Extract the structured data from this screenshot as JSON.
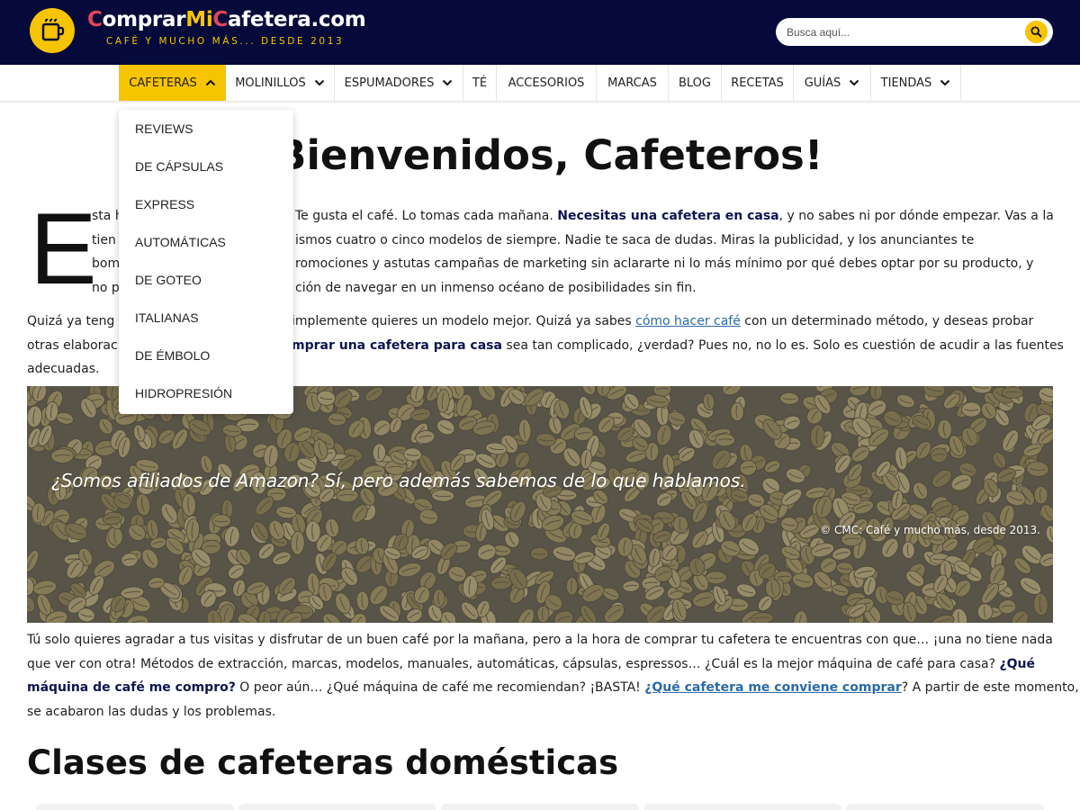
{
  "brand": {
    "title_part1": "Comprar",
    "title_part2": "Mi",
    "title_part3": "Cafetera",
    "title_part4": ".com",
    "title_first_letter": "C",
    "tagline": "CAFÉ Y MUCHO MÁS... DESDE 2013",
    "colors": {
      "header_bg": "#050a3a",
      "accent": "#f6c400",
      "logo_red": "#e2465a",
      "link": "#2b6aa8"
    },
    "logo_icon": "coffee-cup-icon"
  },
  "search": {
    "placeholder": "Busca aquí...",
    "icon": "search-icon"
  },
  "nav": {
    "items": [
      {
        "label": "CAFETERAS",
        "has_dropdown": true,
        "active": true
      },
      {
        "label": "MOLINILLOS",
        "has_dropdown": true
      },
      {
        "label": "ESPUMADORES",
        "has_dropdown": true
      },
      {
        "label": "TÉ",
        "has_dropdown": false
      },
      {
        "label": "ACCESORIOS",
        "has_dropdown": false
      },
      {
        "label": "MARCAS",
        "has_dropdown": false
      },
      {
        "label": "BLOG",
        "has_dropdown": false
      },
      {
        "label": "RECETAS",
        "has_dropdown": false
      },
      {
        "label": "GUÍAS",
        "has_dropdown": true
      },
      {
        "label": "TIENDAS",
        "has_dropdown": true
      }
    ],
    "dropdown": [
      "REVIEWS",
      "DE CÁPSULAS",
      "EXPRESS",
      "AUTOMÁTICAS",
      "DE GOTEO",
      "ITALIANAS",
      "DE ÉMBOLO",
      "HIDROPRESIÓN"
    ]
  },
  "main": {
    "heading": "¡Bienvenidos, Cafeteros!",
    "intro": {
      "dropcap": "E",
      "line1_a": "sta h",
      "line1_b": "Te gusta el café. Lo tomas cada mañana. ",
      "line1_bold": "Necesitas una cafetera en casa",
      "line1_c": ", y no sabes ni por dónde empezar. Vas a la",
      "line2_a": "tien",
      "line2_b": "ismos cuatro o cinco modelos de siempre. Nadie te saca de dudas. Miras la publicidad, y los anunciantes te",
      "line3_a": "bom",
      "line3_b": "romociones y astutas campañas de marketing sin aclararte ni lo más mínimo por qué debes optar por su producto, y",
      "line4_a": "no p",
      "line4_b": "ción de navegar en un inmenso océano de posibilidades sin fin."
    },
    "para2": {
      "line1_a": "Quizá ya teng",
      "line1_b": "implemente quieres un modelo mejor.  Quizá ya sabes ",
      "line1_link": "cómo hacer café",
      "line1_c": " con un determinado método, y deseas probar",
      "line2_a": "otras elaborac",
      "line2_bold": "mprar una cafetera para casa",
      "line2_c": " sea tan complicado, ¿verdad? Pues no, no lo es. Solo es cuestión de acudir a las fuentes",
      "line3": "adecuadas."
    },
    "hero": {
      "tagline": "¿Somos afiliados de Amazon? Sí, pero además sabemos de lo que hablamos.",
      "credit": "© CMC: Café y mucho más, desde 2013."
    },
    "para3": {
      "line1": "Tú solo quieres agradar a tus visitas y disfrutar de un buen café por la mañana, pero a la hora de comprar tu cafetera te encuentras con que… ¡una no tiene nada",
      "line2_a": "que ver con otra! Métodos de extracción, marcas, modelos, manuales, automáticas, cápsulas, espressos… ¿Cuál es la mejor máquina de café para casa? ",
      "line2_bold": "¿Qué",
      "line3_bold": "máquina de café me compro?",
      "line3_a": " O peor aún… ¿Qué máquina de café me recomiendan? ¡BASTA! ",
      "line3_link": "¿Qué cafetera me conviene comprar",
      "line3_c": "? A partir de este momento,",
      "line4": "se acabaron las dudas y los problemas."
    },
    "section_heading": "Clases de cafeteras domésticas"
  }
}
